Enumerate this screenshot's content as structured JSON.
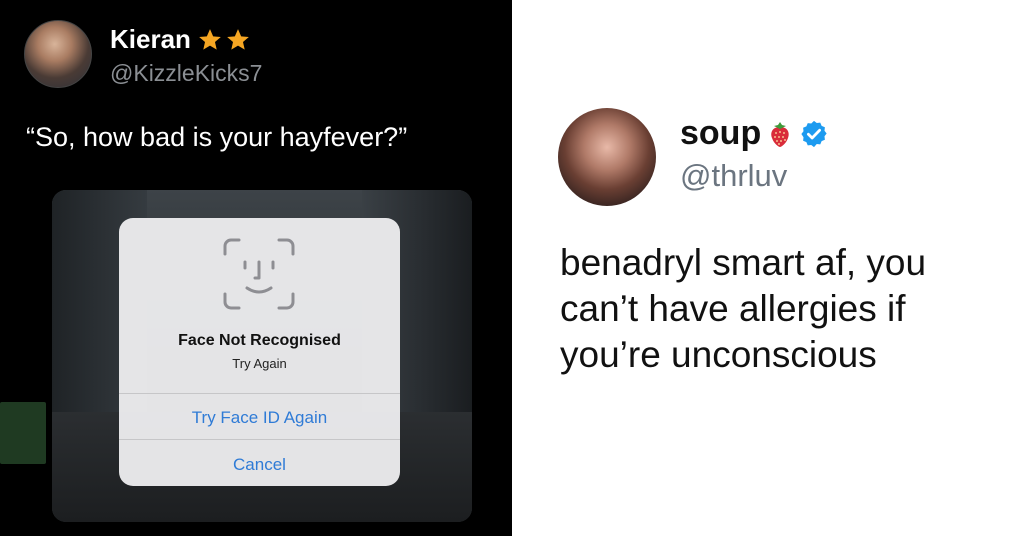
{
  "left_tweet": {
    "name": "Kieran",
    "handle": "@KizzleKicks7",
    "text": "“So, how bad is your hayfever?”",
    "badges": [
      "star-icon",
      "star-icon"
    ],
    "star_color": "#f5a623"
  },
  "face_id_dialog": {
    "title": "Face Not Recognised",
    "subtitle": "Try Again",
    "primary_button": "Try Face ID Again",
    "cancel_button": "Cancel",
    "accent_color": "#2f7bd6"
  },
  "right_tweet": {
    "name": "soup",
    "handle": "@thrluv",
    "text": "benadryl smart af, you can’t have allergies if you’re unconscious",
    "badges": [
      "strawberry-icon",
      "verified-icon"
    ],
    "verified_color": "#1d9bf0"
  }
}
